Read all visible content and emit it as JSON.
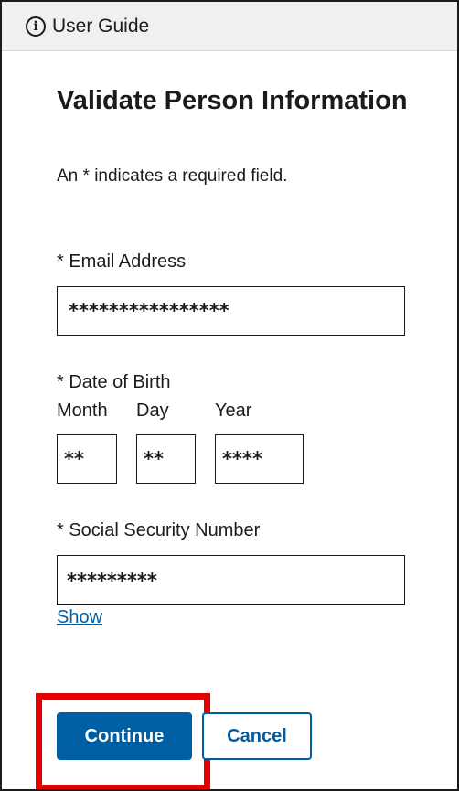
{
  "header": {
    "user_guide_label": "User Guide",
    "icon": "info-icon"
  },
  "form": {
    "title": "Validate Person Information",
    "required_note": "An * indicates a required field.",
    "email": {
      "label": "* Email Address",
      "value": "****************"
    },
    "dob": {
      "label": "* Date of Birth",
      "month_label": "Month",
      "month_value": "**",
      "day_label": "Day",
      "day_value": "**",
      "year_label": "Year",
      "year_value": "****"
    },
    "ssn": {
      "label": "* Social Security Number",
      "value": "*********",
      "show_label": "Show"
    }
  },
  "actions": {
    "continue_label": "Continue",
    "cancel_label": "Cancel"
  },
  "colors": {
    "primary": "#005ea2",
    "highlight": "#e30000",
    "header_bg": "#f0f0f0"
  }
}
